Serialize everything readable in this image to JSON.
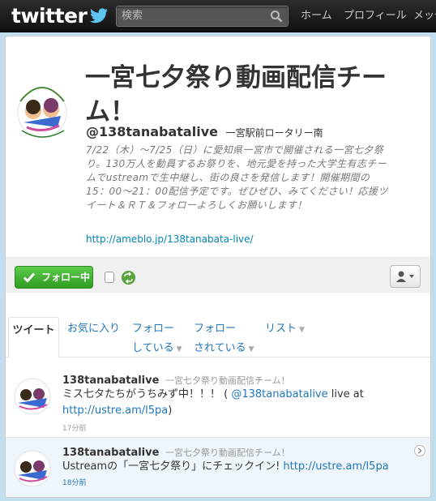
{
  "topbar": {
    "logo_text": "twitter",
    "search_placeholder": "検索",
    "nav": [
      "ホーム",
      "プロフィール",
      "メッセ"
    ]
  },
  "profile": {
    "name": "一宮七夕祭り動画配信チーム！",
    "screen_name": "@138tanabatalive",
    "location": "一宮駅前ロータリー南",
    "bio": "7/22（木）～7/25（日）に愛知県一宮市で開催される一宮七夕祭り。130万人を動員するお祭りを、地元愛を持った大学生有志チームでustreamで生中継し、街の良さを発信します！開催期間の15：00～21：00配信予定です。ぜひぜひ、みてください！応援ツイート＆ＲＴ＆フォローよろしくお願いします！",
    "url": "http://ameblo.jp/138tanabata-live/"
  },
  "actions": {
    "follow_label": "フォロー中"
  },
  "tabs": {
    "tweets": "ツイート",
    "favorites": "お気に入り",
    "following_1": "フォロー",
    "following_2": "している",
    "followers_1": "フォロー",
    "followers_2": "されている",
    "lists": "リスト"
  },
  "tweets": [
    {
      "screen_name": "138tanabatalive",
      "full_name": "一宮七夕祭り動画配信チーム！",
      "text_pre": "ミス七タたちがうちみず中！！！ ( ",
      "mention": "@138tanabatalive",
      "text_mid": " live at",
      "link": "http://ustre.am/l5pa",
      "text_post": ")",
      "time": "17分前"
    },
    {
      "screen_name": "138tanabatalive",
      "full_name": "一宮七夕祭り動画配信チーム！",
      "text_pre": "Ustreamの「一宮七夕祭り」にチェックイン! ",
      "link": "http://ustre.am/l5pa",
      "time": "18分前"
    }
  ],
  "colors": {
    "link": "#2276bb",
    "follow_green": "#3aa52c",
    "topbar": "#1a1a1a",
    "background": "#c0deed"
  }
}
